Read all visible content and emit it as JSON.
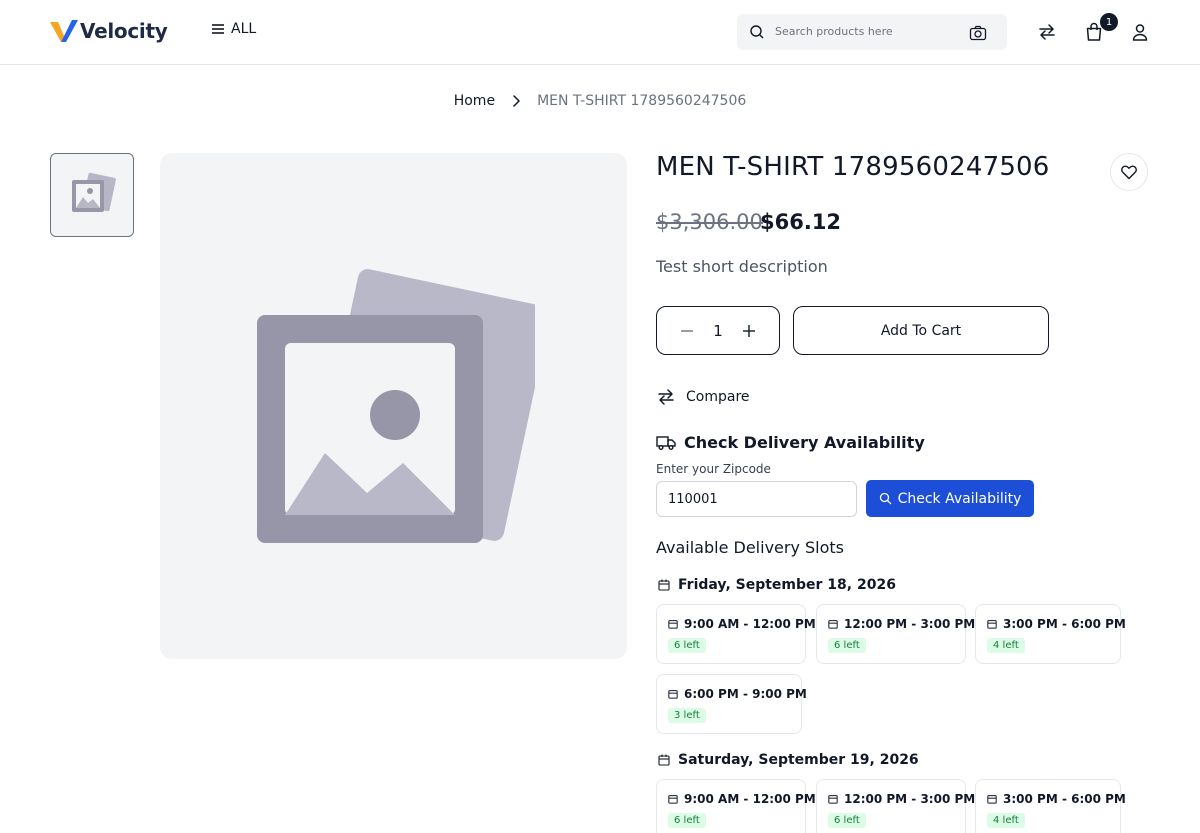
{
  "header": {
    "brand": "Velocity",
    "menu_label": "ALL",
    "search_placeholder": "Search products here",
    "cart_count": "1"
  },
  "breadcrumb": {
    "home": "Home",
    "current": "MEN T-SHIRT 1789560247506"
  },
  "product": {
    "title": "MEN T-SHIRT 1789560247506",
    "price_old": "$3,306.00",
    "price_new": "$66.12",
    "short_description": "Test short description",
    "quantity": "1",
    "add_to_cart_label": "Add To Cart",
    "compare_label": "Compare"
  },
  "delivery": {
    "heading": "Check Delivery Availability",
    "zip_label": "Enter your Zipcode",
    "zip_value": "110001",
    "check_label": "Check Availability",
    "slots_heading": "Available Delivery Slots",
    "days": [
      {
        "date": "Friday, September 18, 2026",
        "slots": [
          {
            "time": "9:00 AM - 12:00 PM",
            "left": "6 left"
          },
          {
            "time": "12:00 PM - 3:00 PM",
            "left": "6 left"
          },
          {
            "time": "3:00 PM - 6:00 PM",
            "left": "4 left"
          },
          {
            "time": "6:00 PM - 9:00 PM",
            "left": "3 left"
          }
        ]
      },
      {
        "date": "Saturday, September 19, 2026",
        "slots": [
          {
            "time": "9:00 AM - 12:00 PM",
            "left": "6 left"
          },
          {
            "time": "12:00 PM - 3:00 PM",
            "left": "6 left"
          },
          {
            "time": "3:00 PM - 6:00 PM",
            "left": "4 left"
          }
        ]
      }
    ]
  },
  "colors": {
    "accent": "#1d4ed8",
    "badge_bg": "#dcfce7",
    "badge_text": "#15803d",
    "logo_orange": "#f5a623"
  },
  "icons": [
    "menu-icon",
    "search-icon",
    "camera-icon",
    "compare-icon",
    "bag-icon",
    "user-icon",
    "chevron-right-icon",
    "heart-icon",
    "minus-icon",
    "plus-icon",
    "truck-icon",
    "calendar-icon",
    "image-placeholder-icon"
  ]
}
